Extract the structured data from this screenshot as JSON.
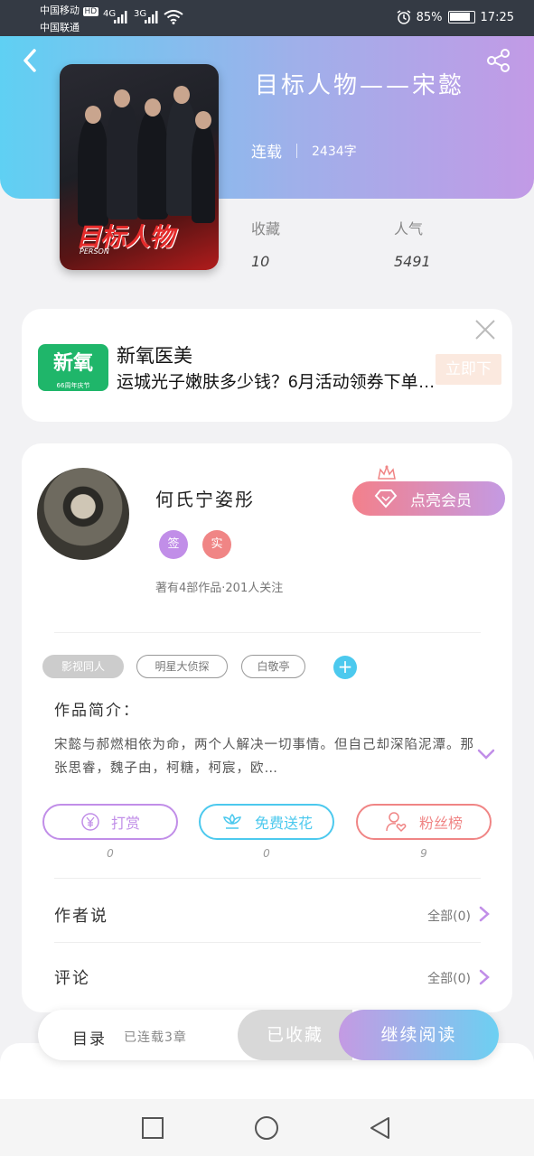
{
  "statusbar": {
    "carrier1": "中国移动",
    "carrier2": "中国联通",
    "hd": "HD",
    "net1": "4G",
    "net2": "3G",
    "battery": "85%",
    "time": "17:25"
  },
  "book": {
    "title": "目标人物——宋懿",
    "status": "连载",
    "word_count": "2434字",
    "cover_title": "目标人物",
    "cover_sub": "PERSON",
    "stats": [
      {
        "label": "收藏",
        "value": "10"
      },
      {
        "label": "人气",
        "value": "5491"
      }
    ]
  },
  "ad": {
    "logo_text": "新氧",
    "logo_sub": "66周年庆节",
    "name": "新氧医美",
    "desc": "运城光子嫩肤多少钱？6月活动领券下单…",
    "button": "立即下"
  },
  "author": {
    "name": "何氏宁姿彤",
    "badges": [
      {
        "text": "签",
        "color": "#c18ee8"
      },
      {
        "text": "实",
        "color": "#f08585"
      }
    ],
    "stats": "著有4部作品·201人关注",
    "vip_label": "点亮会员"
  },
  "tags": [
    "影视同人",
    "明星大侦探",
    "白敬亭"
  ],
  "tag_add": "+",
  "intro": {
    "label": "作品简介：",
    "text": "宋懿与郝燃相依为命，两个人解决一切事情。但自己却深陷泥潭。那张思睿，魏子由，柯糖，柯宸，欧…"
  },
  "actions": [
    {
      "label": "打赏",
      "count": "0",
      "color": "#c18ee8"
    },
    {
      "label": "免费送花",
      "count": "0",
      "color": "#4cc9ee"
    },
    {
      "label": "粉丝榜",
      "count": "9",
      "color": "#f08585"
    }
  ],
  "rows": [
    {
      "label": "作者说",
      "right": "全部(0)"
    },
    {
      "label": "评论",
      "right": "全部(0)"
    }
  ],
  "bottom": {
    "toc": "目录",
    "toc_sub": "已连载3章",
    "collected": "已收藏",
    "read": "继续阅读"
  },
  "icons": {
    "back": "back-icon",
    "share": "share-icon",
    "close": "close-icon",
    "crown": "crown-icon",
    "diamond": "diamond-icon",
    "yen": "yen-icon",
    "flower": "flower-icon",
    "fans": "fans-icon",
    "chevron": "chevron-right-icon"
  }
}
